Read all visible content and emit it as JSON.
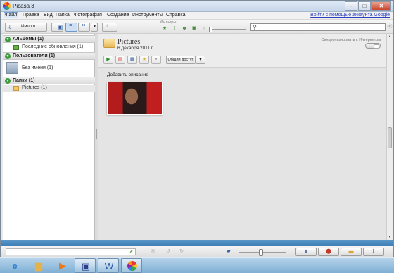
{
  "window": {
    "title": "Picasa 3",
    "controls": {
      "minimize": "–",
      "maximize": "□",
      "close": "✕"
    }
  },
  "menu": {
    "items": [
      "Файл",
      "Правка",
      "Вид",
      "Папка",
      "Фотография",
      "Создание",
      "Инструменты",
      "Справка"
    ],
    "signin": "Войти с помощью аккаунта Google"
  },
  "toolbar": {
    "import_label": "Импорт",
    "filters_label": "Фильтры",
    "filter_icons": [
      "star-icon",
      "upload-icon",
      "person-icon",
      "movie-icon",
      "geotag-icon"
    ],
    "search_value": ""
  },
  "sidebar": {
    "sections": [
      {
        "label": "Альбомы (1)",
        "items": [
          {
            "label": "Последние обновления (1)",
            "icon": "recent-updates-icon"
          }
        ]
      },
      {
        "label": "Пользователи (1)",
        "items": [
          {
            "label": "Без имени (1)",
            "icon": "person-avatar-icon"
          }
        ]
      },
      {
        "label": "Папки (1)",
        "items": [
          {
            "label": "Pictures (1)",
            "icon": "folder-icon"
          }
        ]
      }
    ]
  },
  "album": {
    "title": "Pictures",
    "date": "6 декабря 2011 г.",
    "sync_label": "Синхронизировать с Интернетом",
    "share_label": "Общий доступ",
    "add_description": "Добавить описание",
    "action_icons": [
      "play-icon",
      "slideshow-icon",
      "collage-icon",
      "star-icon",
      "save-icon"
    ]
  },
  "colors": {
    "accent_blue": "#3f7fb6",
    "filter_green": "#4c8a3c",
    "link": "#2b3fbf"
  },
  "taskbar": {
    "apps": [
      "ie-icon",
      "explorer-icon",
      "media-player-icon",
      "save-icon",
      "word-icon",
      "picasa-icon"
    ]
  }
}
